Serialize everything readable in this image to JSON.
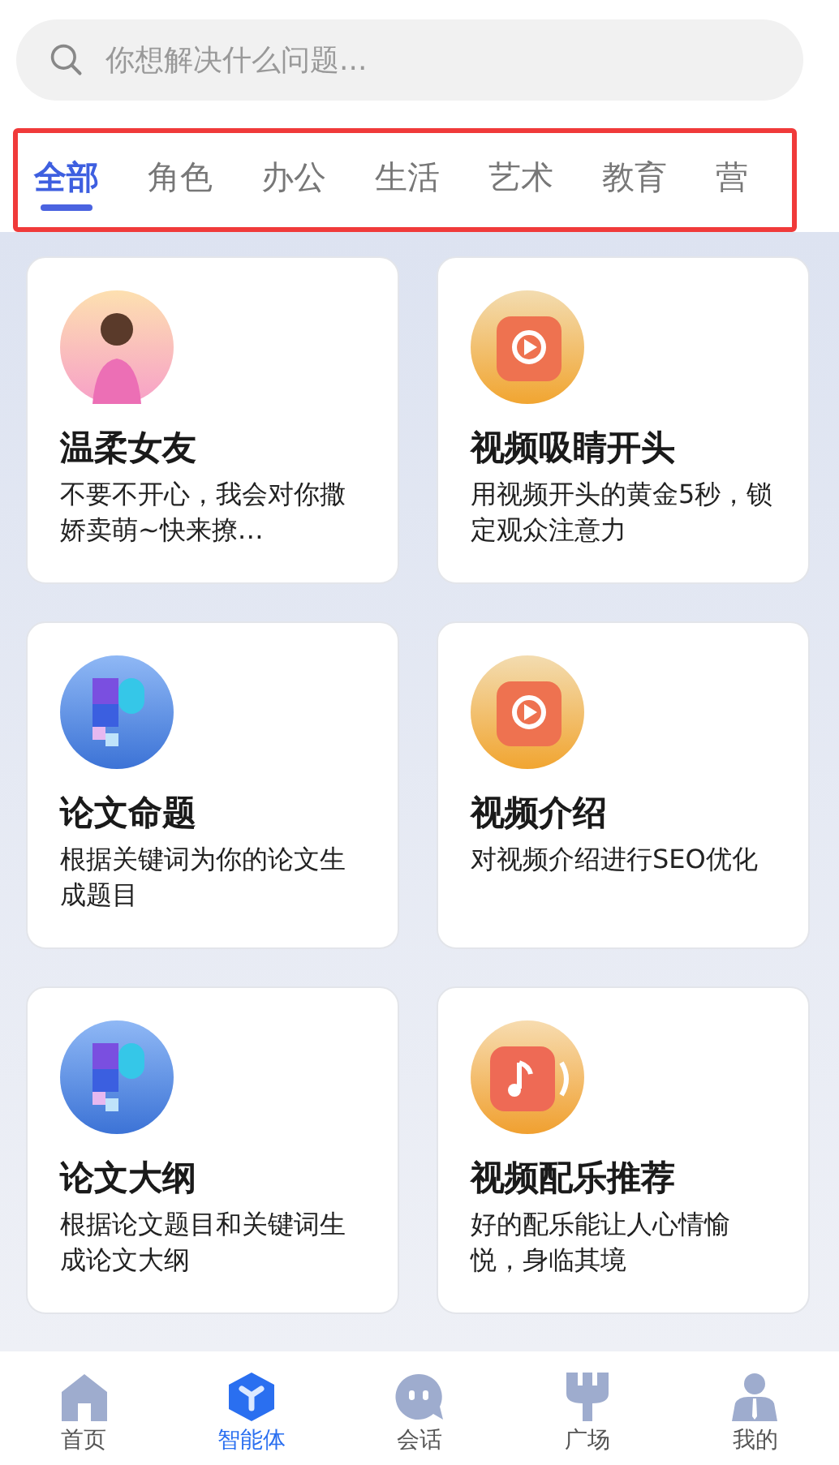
{
  "search": {
    "placeholder": "你想解决什么问题..."
  },
  "tabs": [
    {
      "label": "全部",
      "selected": true
    },
    {
      "label": "角色",
      "selected": false
    },
    {
      "label": "办公",
      "selected": false
    },
    {
      "label": "生活",
      "selected": false
    },
    {
      "label": "艺术",
      "selected": false
    },
    {
      "label": "教育",
      "selected": false
    },
    {
      "label": "营",
      "selected": false
    }
  ],
  "cards": [
    {
      "kind": "person",
      "title": "温柔女友",
      "description": "不要不开心，我会对你撒娇卖萌~快来撩…"
    },
    {
      "kind": "video",
      "title": "视频吸睛开头",
      "description": "用视频开头的黄金5秒，锁定观众注意力"
    },
    {
      "kind": "document",
      "title": "论文命题",
      "description": "根据关键词为你的论文生成题目"
    },
    {
      "kind": "video",
      "title": "视频介绍",
      "description": "对视频介绍进行SEO优化"
    },
    {
      "kind": "document",
      "title": "论文大纲",
      "description": "根据论文题目和关键词生成论文大纲"
    },
    {
      "kind": "music",
      "title": "视频配乐推荐",
      "description": "好的配乐能让人心情愉悦，身临其境"
    }
  ],
  "nav": [
    {
      "kind": "home",
      "label": "首页",
      "selected": false
    },
    {
      "kind": "agent",
      "label": "智能体",
      "selected": true
    },
    {
      "kind": "chat",
      "label": "会话",
      "selected": false
    },
    {
      "kind": "plaza",
      "label": "广场",
      "selected": false
    },
    {
      "kind": "me",
      "label": "我的",
      "selected": false
    }
  ]
}
